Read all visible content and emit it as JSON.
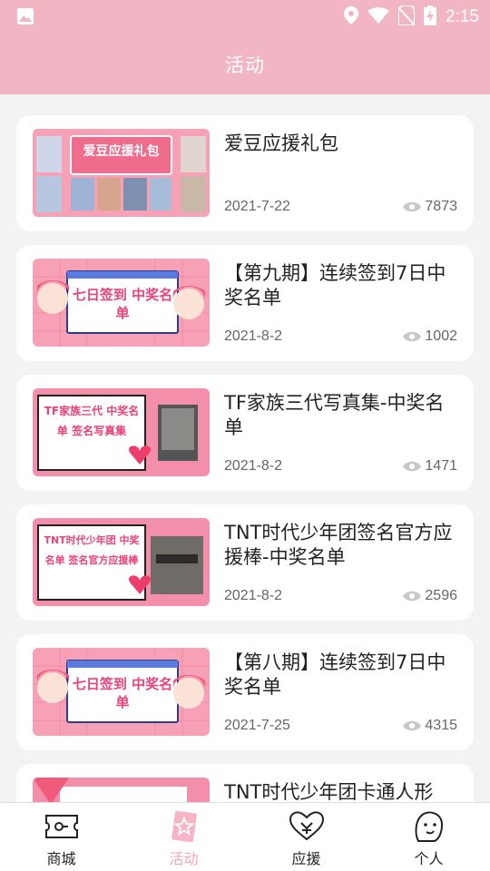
{
  "status_bar": {
    "time": "2:15"
  },
  "header": {
    "title": "活动"
  },
  "cards": [
    {
      "title": "爱豆应援礼包",
      "date": "2021-7-22",
      "views": "7873",
      "thumb_text": "爱豆应援礼包"
    },
    {
      "title": "【第九期】连续签到7日中奖名单",
      "date": "2021-8-2",
      "views": "1002",
      "thumb_text": "七日签到 中奖名单"
    },
    {
      "title": "TF家族三代写真集-中奖名单",
      "date": "2021-8-2",
      "views": "1471",
      "thumb_text": "TF家族三代 中奖名单 签名写真集"
    },
    {
      "title": "TNT时代少年团签名官方应援棒-中奖名单",
      "date": "2021-8-2",
      "views": "2596",
      "thumb_text": "TNT时代少年团 中奖名单 签名官方应援棒"
    },
    {
      "title": "【第八期】连续签到7日中奖名单",
      "date": "2021-7-25",
      "views": "4315",
      "thumb_text": "七日签到 中奖名单"
    },
    {
      "title": "TNT时代少年团卡通人形",
      "date": "",
      "views": "",
      "thumb_text": ""
    }
  ],
  "tabbar": [
    {
      "label": "商城",
      "icon": "ticket-icon",
      "active": false
    },
    {
      "label": "活动",
      "icon": "star-card-icon",
      "active": true
    },
    {
      "label": "应援",
      "icon": "heart-icon",
      "active": false
    },
    {
      "label": "个人",
      "icon": "face-icon",
      "active": false
    }
  ],
  "colors": {
    "header_bg": "#f2b5c4",
    "active_tab": "#f2a5b9",
    "thumb_pink": "#f7a1b6"
  }
}
